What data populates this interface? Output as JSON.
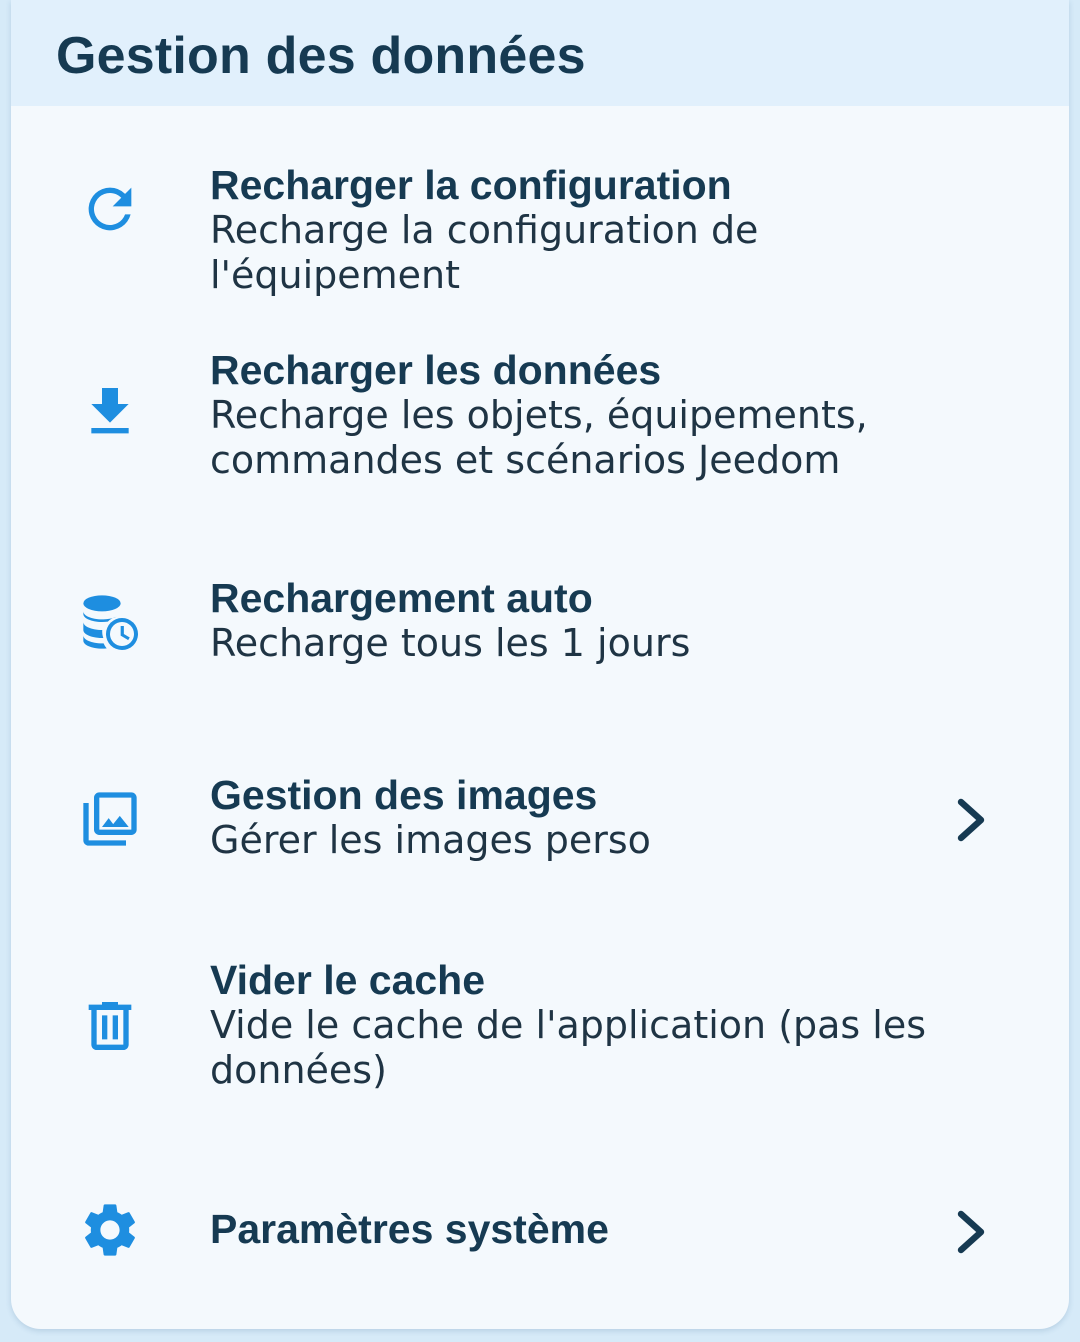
{
  "section": {
    "title": "Gestion des données"
  },
  "items": [
    {
      "icon": "refresh-icon",
      "title": "Recharger la configuration",
      "subtitle": "Recharge la configuration de l'équipement"
    },
    {
      "icon": "download-icon",
      "title": "Recharger les données",
      "subtitle_line1": "Recharge les objets, équipements,",
      "subtitle_line2": "commandes et scénarios Jeedom"
    },
    {
      "icon": "database-clock-icon",
      "title": "Rechargement auto",
      "subtitle": "Recharge tous les 1 jours"
    },
    {
      "icon": "image-collection-icon",
      "title": "Gestion des images",
      "subtitle": "Gérer les images perso",
      "chevron": "chevron-right-icon"
    },
    {
      "icon": "trash-icon",
      "title": "Vider le cache",
      "subtitle_line1": "Vide le cache de l'application (pas les",
      "subtitle_line2": "données)"
    },
    {
      "icon": "gear-icon",
      "title": "Paramètres système",
      "chevron": "chevron-right-icon"
    }
  ],
  "colors": {
    "accent": "#1e8ee0",
    "title_text": "#163a52",
    "header_bg": "#e1f0fc",
    "card_bg": "#f4f9fd",
    "page_bg": "#d6eaf8"
  }
}
